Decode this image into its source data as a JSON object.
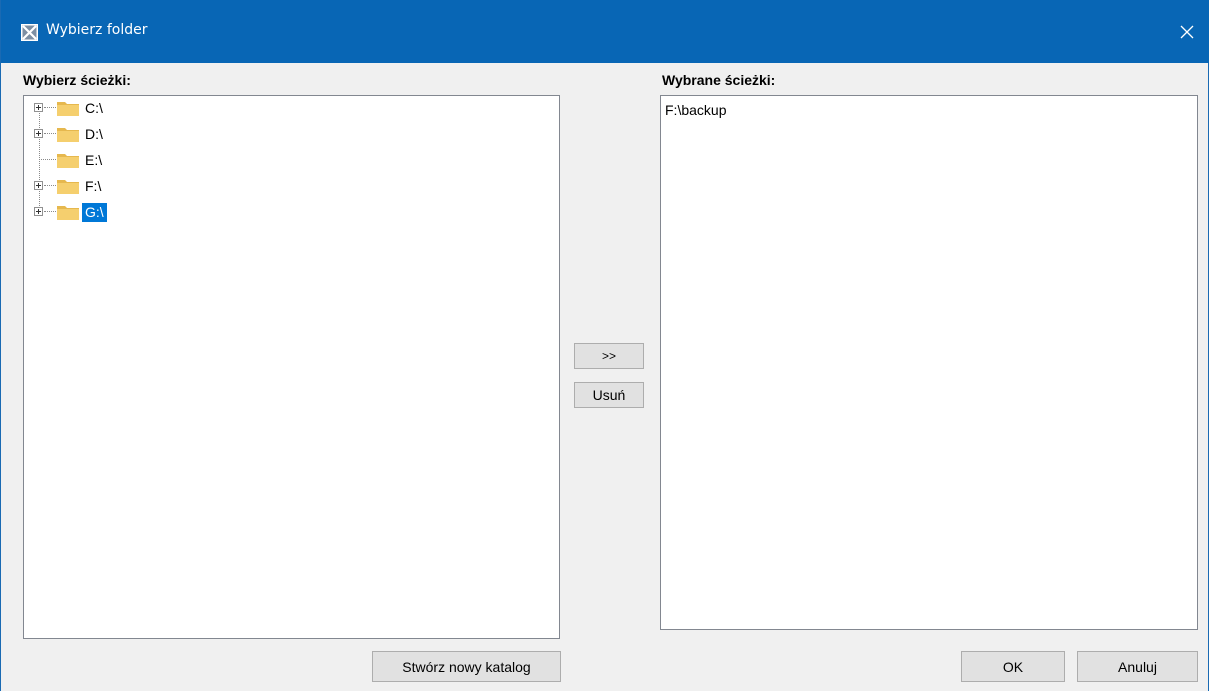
{
  "window": {
    "title": "Wybierz folder"
  },
  "left_panel": {
    "label": "Wybierz ścieżki:",
    "tree": [
      {
        "label": "C:\\",
        "expandable": true,
        "selected": false
      },
      {
        "label": "D:\\",
        "expandable": true,
        "selected": false
      },
      {
        "label": "E:\\",
        "expandable": false,
        "selected": false
      },
      {
        "label": "F:\\",
        "expandable": true,
        "selected": false
      },
      {
        "label": "G:\\",
        "expandable": true,
        "selected": true
      }
    ],
    "create_button": "Stwórz nowy katalog"
  },
  "middle": {
    "add_button": ">>",
    "remove_button": "Usuń"
  },
  "right_panel": {
    "label": "Wybrane ścieżki:",
    "items": [
      "F:\\backup"
    ]
  },
  "footer": {
    "ok_button": "OK",
    "cancel_button": "Anuluj"
  },
  "colors": {
    "titlebar": "#0866b5",
    "selection": "#0078d7",
    "folder": "#f5cf6e"
  }
}
